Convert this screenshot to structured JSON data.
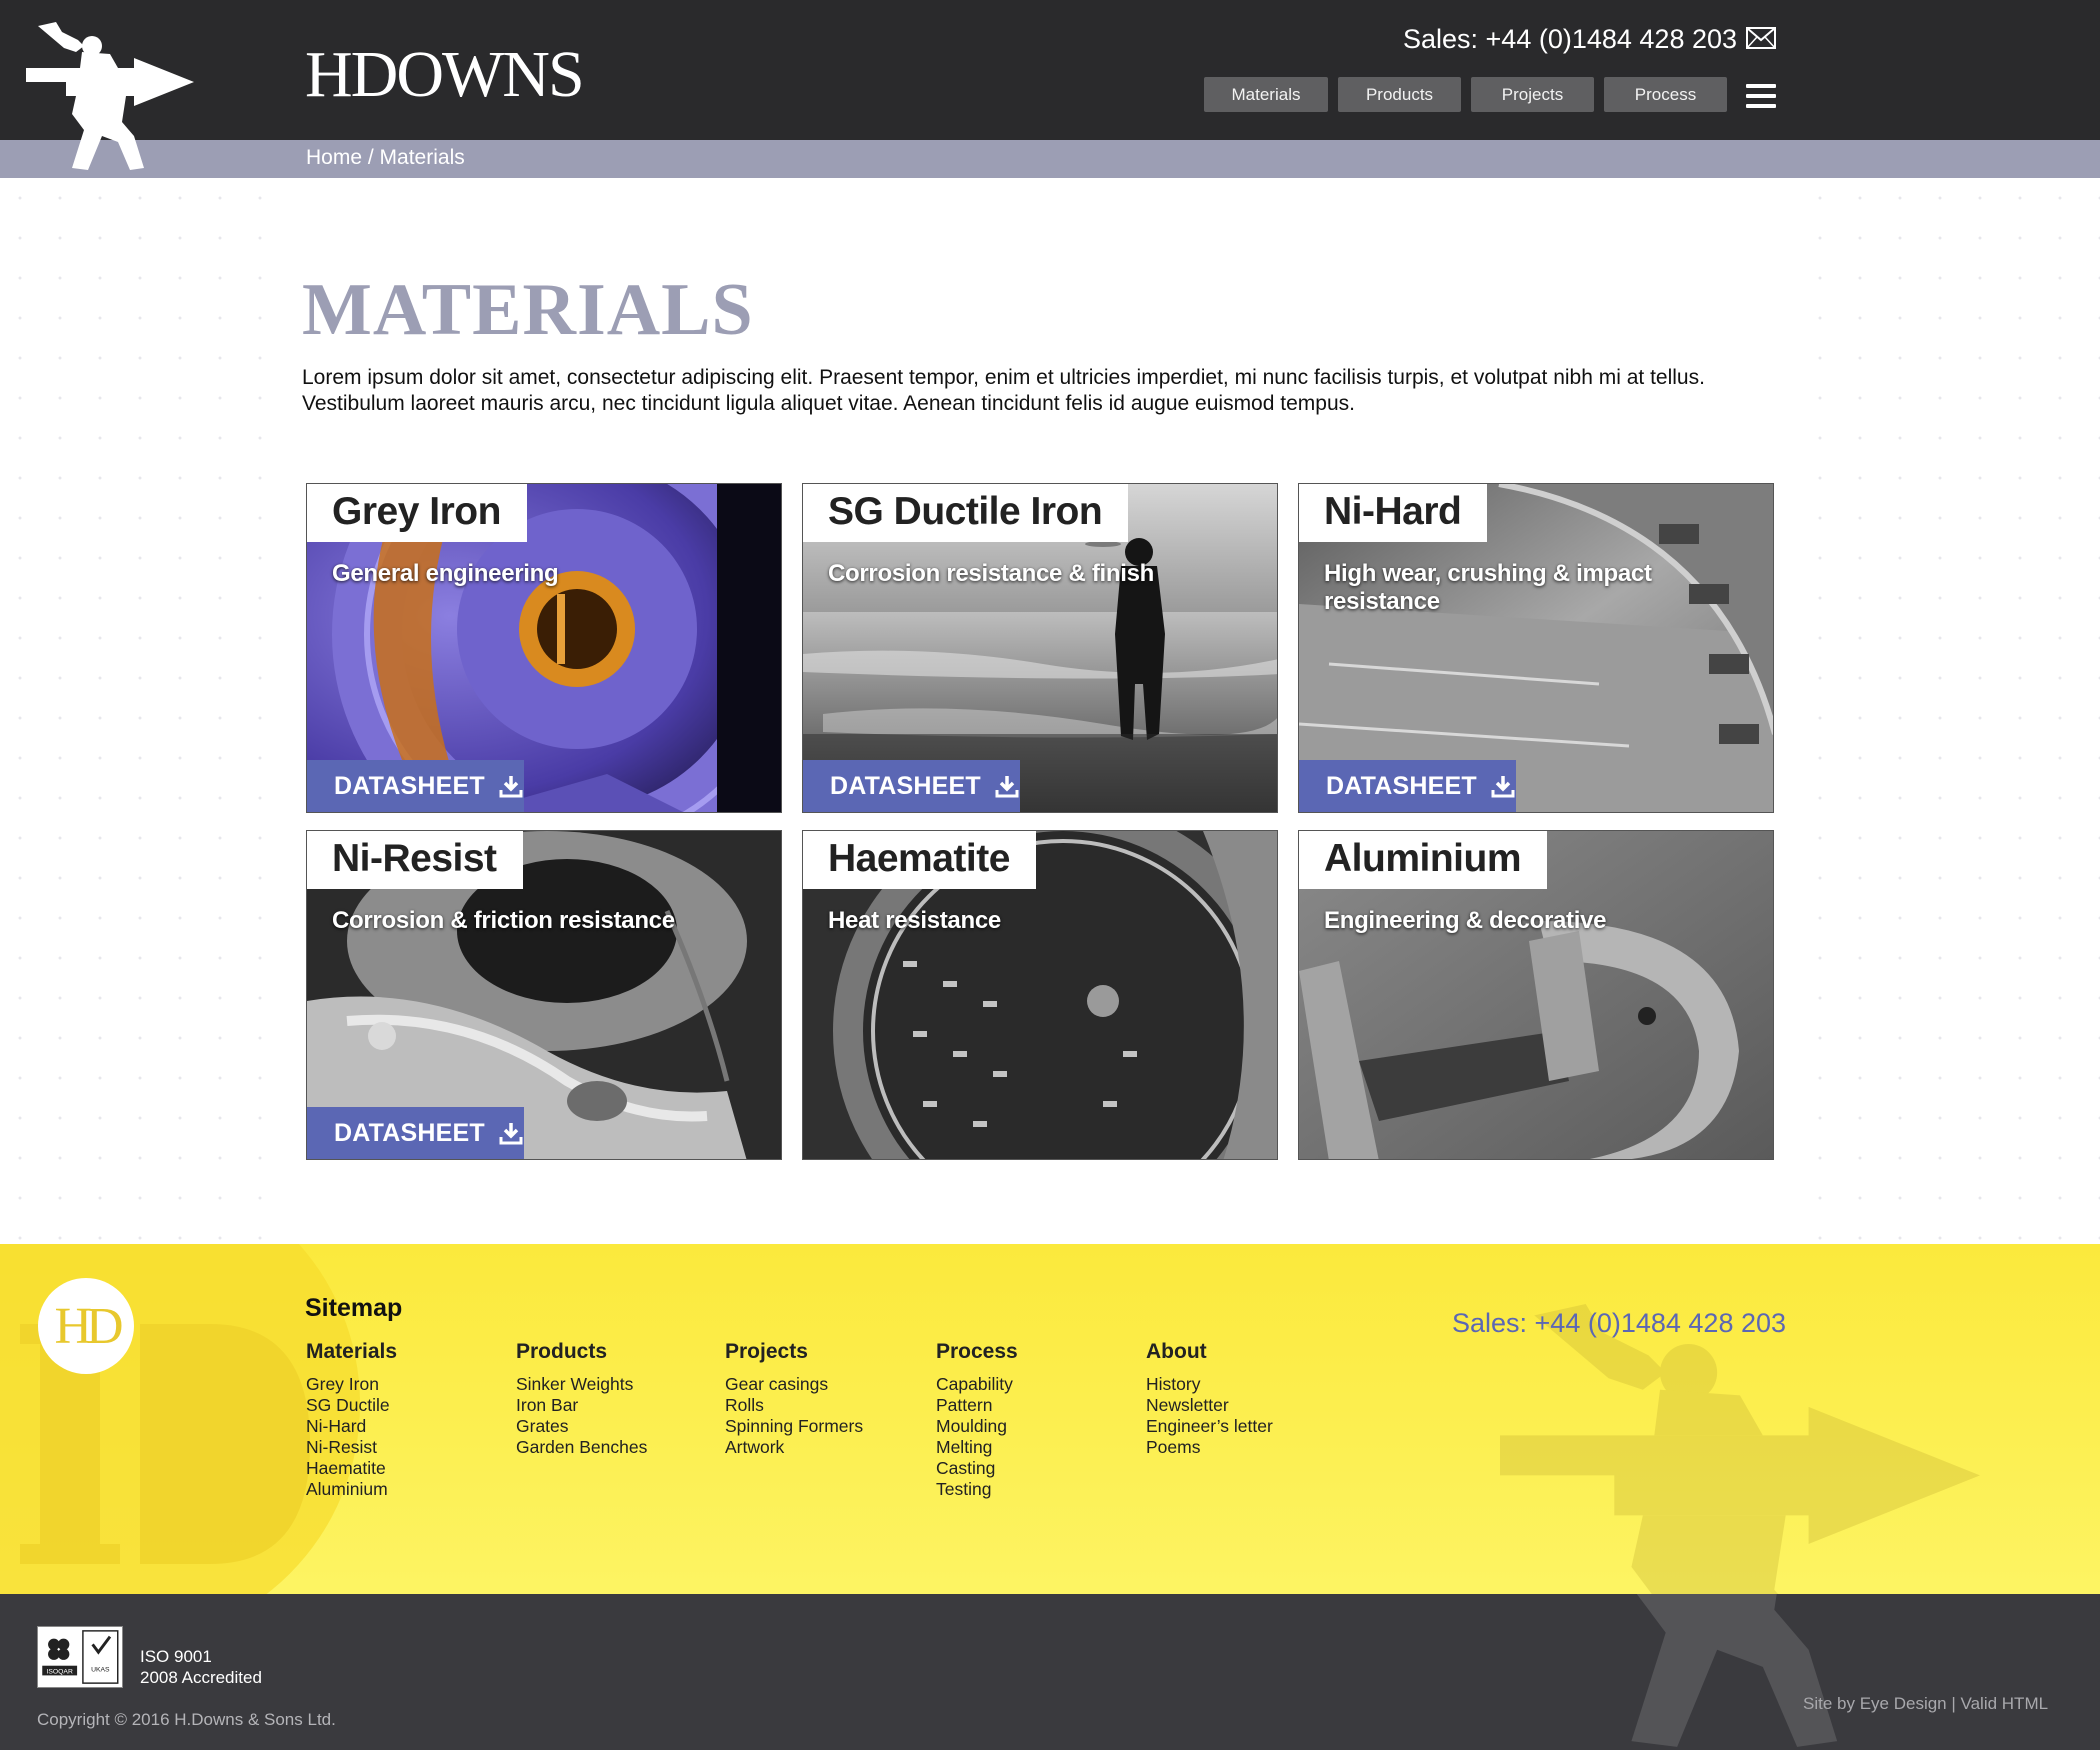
{
  "header": {
    "brand": "HDOWNS",
    "sales": "Sales: +44 (0)1484 428 203",
    "nav": [
      "Materials",
      "Products",
      "Projects",
      "Process"
    ]
  },
  "breadcrumb": {
    "home": "Home",
    "separator": " / ",
    "current": "Materials"
  },
  "main": {
    "title": "MATERIALS",
    "intro": "Lorem ipsum dolor sit amet, consectetur adipiscing elit. Praesent tempor, enim et ultricies imperdiet, mi nunc facilisis turpis, et volutpat nibh mi at tellus. Vestibulum laoreet mauris arcu, nec tincidunt ligula aliquet vitae. Aenean tincidunt felis id augue euismod tempus.",
    "datasheet_label": "DATASHEET",
    "cards": [
      {
        "title": "Grey Iron",
        "subtitle": "General engineering"
      },
      {
        "title": "SG Ductile Iron",
        "subtitle": "Corrosion resistance & finish"
      },
      {
        "title": "Ni-Hard",
        "subtitle": "High wear, crushing & impact resistance"
      },
      {
        "title": "Ni-Resist",
        "subtitle": "Corrosion & friction resistance"
      },
      {
        "title": "Haematite",
        "subtitle": "Heat resistance"
      },
      {
        "title": "Aluminium",
        "subtitle": "Engineering & decorative"
      }
    ]
  },
  "footer": {
    "logo_text": "HD",
    "sitemap_title": "Sitemap",
    "sales": "Sales: +44 (0)1484 428 203",
    "columns": [
      {
        "heading": "Materials",
        "links": [
          "Grey Iron",
          "SG Ductile",
          "Ni-Hard",
          "Ni-Resist",
          "Haematite",
          "Aluminium"
        ]
      },
      {
        "heading": "Products",
        "links": [
          "Sinker Weights",
          "Iron Bar",
          "Grates",
          "Garden Benches"
        ]
      },
      {
        "heading": "Projects",
        "links": [
          "Gear casings",
          "Rolls",
          "Spinning Formers",
          "Artwork"
        ]
      },
      {
        "heading": "Process",
        "links": [
          "Capability",
          "Pattern",
          "Moulding",
          "Melting",
          "Casting",
          "Testing"
        ]
      },
      {
        "heading": "About",
        "links": [
          "History",
          "Newsletter",
          "Engineer’s letter",
          "Poems"
        ]
      }
    ]
  },
  "bottom": {
    "iso_line1": "ISO 9001",
    "iso_line2": "2008 Accredited",
    "iso_logo_text_left": "ISOQAR",
    "iso_logo_text_right": "UKAS",
    "copyright": "Copyright © 2016 H.Downs & Sons Ltd.",
    "site_by": "Site by Eye Design",
    "divider": " | ",
    "valid": "Valid HTML"
  },
  "colors": {
    "header_bg": "#2a2a2c",
    "crumb_bg": "#9c9eb4",
    "accent": "#5b67b4",
    "footer_yellow": "#fbe93c",
    "bottom_bg": "#3a3a3e"
  }
}
